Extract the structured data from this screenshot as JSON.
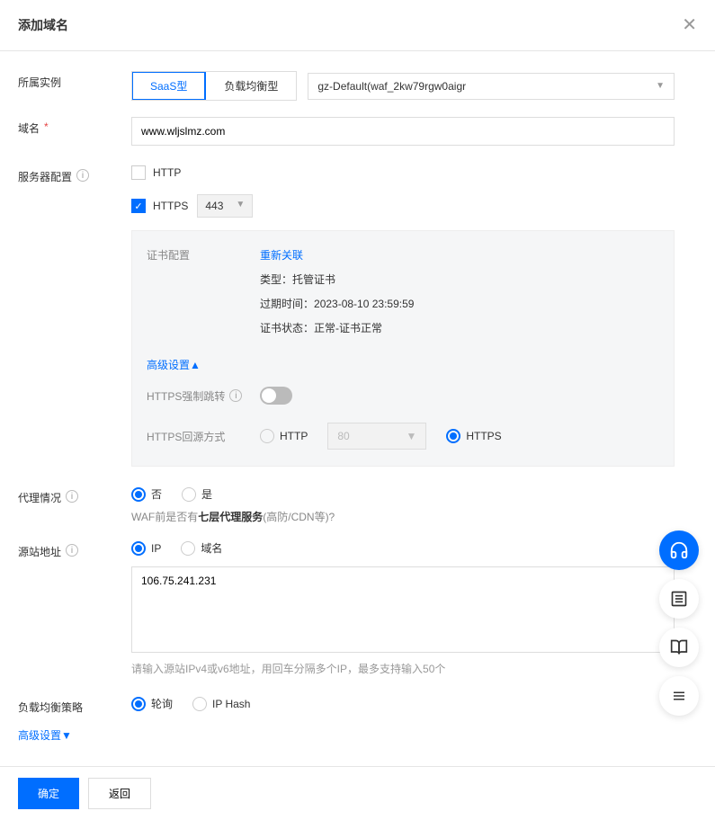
{
  "header": {
    "title": "添加域名"
  },
  "instance": {
    "label": "所属实例",
    "tabs": [
      "SaaS型",
      "负载均衡型"
    ],
    "selected": "gz-Default(waf_2kw79rgw0aigr"
  },
  "domain": {
    "label": "域名",
    "value": "www.wljslmz.com"
  },
  "serverConfig": {
    "label": "服务器配置",
    "http": {
      "label": "HTTP",
      "checked": false
    },
    "https": {
      "label": "HTTPS",
      "checked": true,
      "port": "443"
    }
  },
  "cert": {
    "label": "证书配置",
    "relink": "重新关联",
    "type_l": "类型：",
    "type_v": "托管证书",
    "exp_l": "过期时间：",
    "exp_v": "2023-08-10 23:59:59",
    "status_l": "证书状态：",
    "status_v": "正常-证书正常",
    "advanced": "高级设置▲",
    "forceJump": {
      "label": "HTTPS强制跳转",
      "on": false
    },
    "originMethod": {
      "label": "HTTPS回源方式",
      "http": "HTTP",
      "port": "80",
      "https": "HTTPS",
      "selected": "HTTPS"
    }
  },
  "proxy": {
    "label": "代理情况",
    "no": "否",
    "yes": "是",
    "hint1": "WAF前是否有",
    "hint_b": "七层代理服务",
    "hint2": "(高防/CDN等)?"
  },
  "origin": {
    "label": "源站地址",
    "ip": "IP",
    "domain": "域名",
    "value": "106.75.241.231",
    "help": "请输入源站IPv4或v6地址，用回车分隔多个IP，最多支持输入50个"
  },
  "lb": {
    "label": "负载均衡策略",
    "poll": "轮询",
    "hash": "IP Hash"
  },
  "advanced": "高级设置▼",
  "footer": {
    "ok": "确定",
    "back": "返回"
  },
  "fab": {
    "headset": "headset",
    "list": "list",
    "book": "book",
    "menu": "menu"
  }
}
